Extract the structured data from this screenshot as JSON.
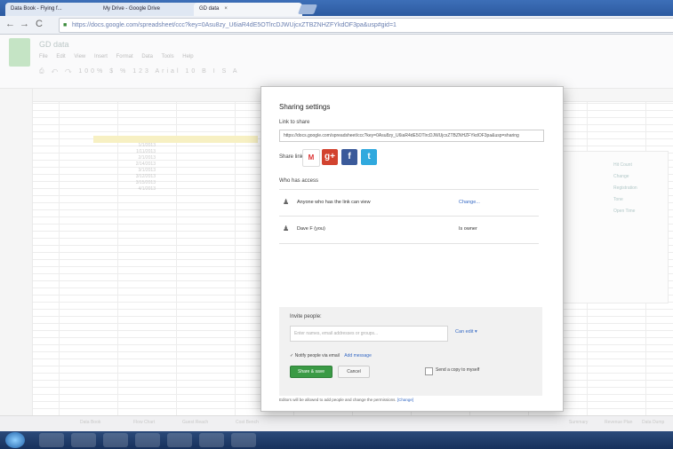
{
  "browser": {
    "tabs": [
      {
        "label": "Data Book - Flying f..."
      },
      {
        "label": "My Drive - Google Drive"
      },
      {
        "label": "GD data"
      }
    ],
    "url": "https://docs.google.com/spreadsheet/ccc?key=0Asu8zy_U6iaR4dE5OTlrcDJWUjcxZTBZNHZFYkdOF3pa&usp#gid=1"
  },
  "sheet": {
    "title": "GD data",
    "menu": [
      "File",
      "Edit",
      "View",
      "Insert",
      "Format",
      "Data",
      "Tools",
      "Help"
    ],
    "toolbar": "⎙ ↶ ↷ 100% $ % 123 Arial 10 B I S A",
    "cells": [
      "1/1/2013",
      "1/11/2013",
      "2/1/2013",
      "2/14/2013",
      "3/1/2013",
      "3/12/2013",
      "3/15/2013",
      "4/1/2013"
    ],
    "legend": [
      "Hit Count",
      "Change",
      "Registration",
      "Tone",
      "Open Time"
    ],
    "sheet_tabs": [
      "Data Book",
      "Flow Chart",
      "Guest Reach",
      "Cost Bench",
      "Summary",
      "Revenue Plan",
      "Data Dump"
    ]
  },
  "dialog": {
    "title": "Sharing settings",
    "link_label": "Link to share",
    "link_url": "https://docs.google.com/spreadsheet/ccc?key=0Asu8zy_U6iaR4dE5OTlrcDJWUjcxZTBZNHZFYkdOF3pa&usp=sharing",
    "share_via_label": "Share link via:",
    "who_has_access_label": "Who has access",
    "access_rows": [
      {
        "text": "Anyone who has the link can view",
        "action": "Change..."
      },
      {
        "text": "Dave F (you)",
        "role": "Is owner"
      }
    ],
    "invite_label": "Invite people:",
    "invite_placeholder": "Enter names, email addresses or groups...",
    "permission": "Can edit",
    "notify_label": "Notify people via email",
    "add_message": "Add message",
    "share_button": "Share & save",
    "cancel_button": "Cancel",
    "copy_label": "Send a copy to myself",
    "footer_note": "Editors will be allowed to add people and change the permissions.",
    "footer_change": "[Change]"
  }
}
